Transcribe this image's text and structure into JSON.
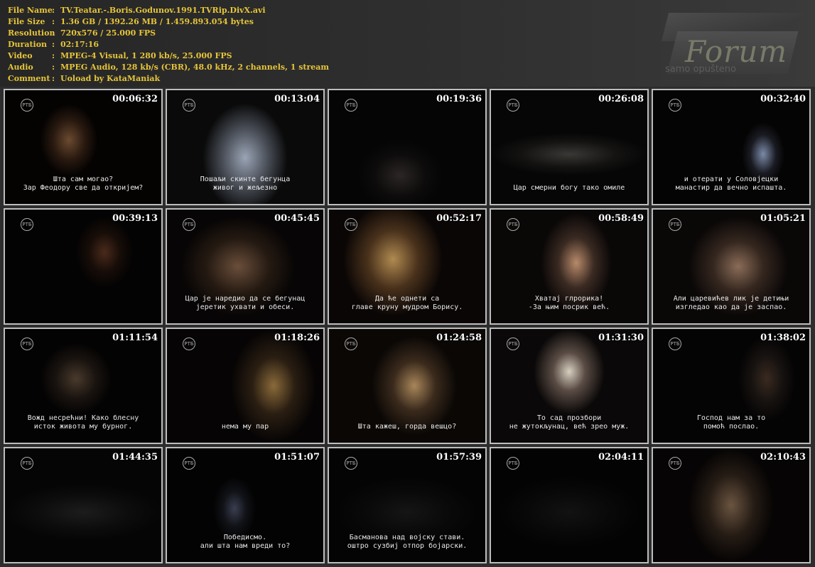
{
  "info": [
    {
      "key": "File Name",
      "value": "TV.Teatar.-.Boris.Godunov.1991.TVRip.DivX.avi"
    },
    {
      "key": "File Size",
      "value": "1.36 GB  / 1392.26 MB  / 1.459.893.054  bytes"
    },
    {
      "key": "Resolution",
      "value": "720x576 / 25.000 FPS"
    },
    {
      "key": "Duration",
      "value": "02:17:16"
    },
    {
      "key": "Video",
      "value": "MPEG-4 Visual, 1 280 kb/s, 25.000 FPS"
    },
    {
      "key": "Audio",
      "value": "MPEG Audio, 128 kb/s (CBR), 48.0 kHz, 2 channels, 1 stream"
    },
    {
      "key": "Comment",
      "value": "Uoload by KataManiak"
    }
  ],
  "watermark": {
    "text": "Forum",
    "subtext": "samo opušteno"
  },
  "logo_text": "РТБ",
  "thumbnails": [
    {
      "time": "00:06:32",
      "subtitle": "Шта сам могао?\nЗар Феодору све да откријем?"
    },
    {
      "time": "00:13:04",
      "subtitle": "Пошаљи скинте бегунца\nживог и жељезно"
    },
    {
      "time": "00:19:36",
      "subtitle": ""
    },
    {
      "time": "00:26:08",
      "subtitle": "Цар смерни богу тако омиле"
    },
    {
      "time": "00:32:40",
      "subtitle": "и отерати у Соловјецки\nманастир да вечно испашта."
    },
    {
      "time": "00:39:13",
      "subtitle": ""
    },
    {
      "time": "00:45:45",
      "subtitle": "Цар је наредио да се бегунац\nјеретик ухвати и обеси."
    },
    {
      "time": "00:52:17",
      "subtitle": "Да ће однети са\nглаве круну мудром Борису."
    },
    {
      "time": "00:58:49",
      "subtitle": "Хватај глрорика!\n-За њим посрик већ."
    },
    {
      "time": "01:05:21",
      "subtitle": "Али царевићев лик је детињи\nизгледао као да је заспао."
    },
    {
      "time": "01:11:54",
      "subtitle": "Вожд несрећни! Како блесну\nисток живота му бурног."
    },
    {
      "time": "01:18:26",
      "subtitle": "нема му пар"
    },
    {
      "time": "01:24:58",
      "subtitle": "Шта кажеш, горда вешцо?"
    },
    {
      "time": "01:31:30",
      "subtitle": "То сад прозбори\nне жутокљунац, већ зрео муж."
    },
    {
      "time": "01:38:02",
      "subtitle": "Господ нам за то\nпомоћ послао."
    },
    {
      "time": "01:44:35",
      "subtitle": ""
    },
    {
      "time": "01:51:07",
      "subtitle": "Победисмо.\nали шта нам вреди то?"
    },
    {
      "time": "01:57:39",
      "subtitle": "Басманова над војску стави.\nоштро сузбиј отпор бојарски."
    },
    {
      "time": "02:04:11",
      "subtitle": ""
    },
    {
      "time": "02:10:43",
      "subtitle": ""
    }
  ]
}
